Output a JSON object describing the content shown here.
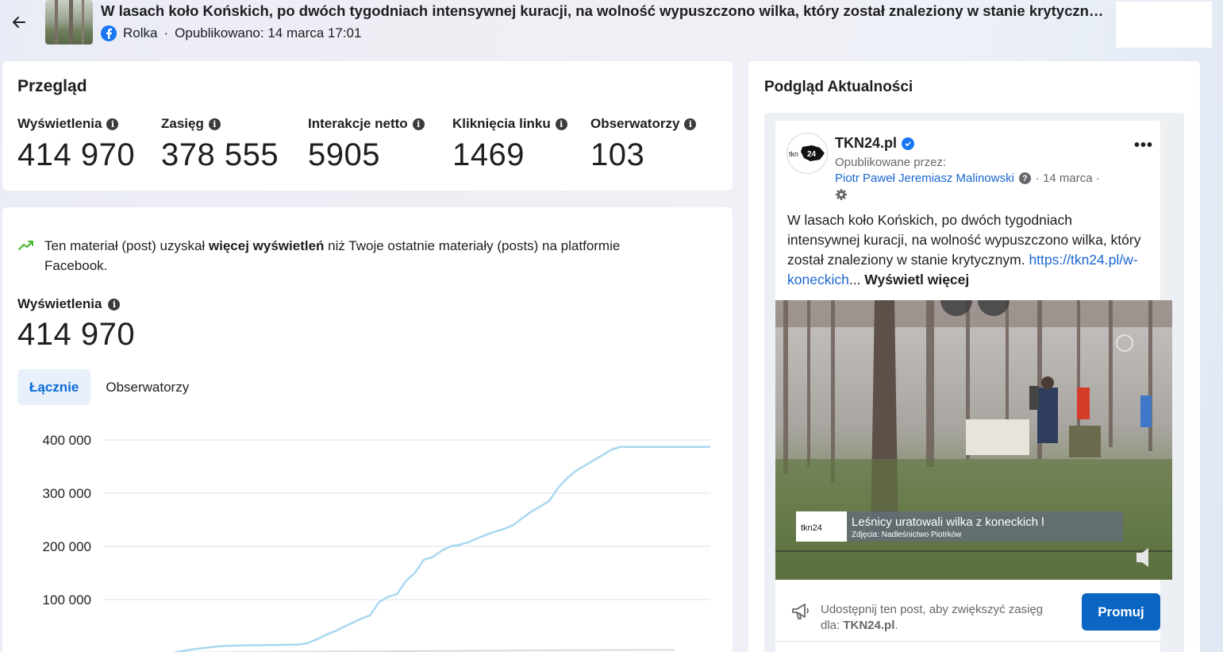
{
  "header": {
    "title": "W lasach koło Końskich, po dwóch tygodniach intensywnej kuracji, na wolność wypuszczono wilka, który został znaleziony w stanie krytycznym.",
    "type": "Rolka",
    "published": "Opublikowano: 14 marca 17:01"
  },
  "overview": {
    "title": "Przegląd",
    "metrics": [
      {
        "label": "Wyświetlenia",
        "value": "414 970"
      },
      {
        "label": "Zasięg",
        "value": "378 555"
      },
      {
        "label": "Interakcje netto",
        "value": "5905"
      },
      {
        "label": "Kliknięcia linku",
        "value": "1469"
      },
      {
        "label": "Obserwatorzy",
        "value": "103"
      }
    ]
  },
  "views": {
    "insight_pre": "Ten materiał (post) uzyskał ",
    "insight_bold": "więcej wyświetleń",
    "insight_post": " niż Twoje ostatnie materiały (posts) na platformie Facebook.",
    "label": "Wyświetlenia",
    "value": "414 970",
    "tabs": [
      "Łącznie",
      "Obserwatorzy"
    ]
  },
  "chart_data": {
    "type": "line",
    "ylim": [
      0,
      420000
    ],
    "yticks": [
      100000,
      200000,
      300000,
      400000
    ],
    "ytick_labels": [
      "100 000",
      "200 000",
      "300 000",
      "400 000"
    ],
    "grid": true,
    "series": [
      {
        "color": "#a8d8f0",
        "x": [
          0,
          2,
          4,
          6,
          8,
          10,
          12,
          14,
          16,
          18,
          20,
          22,
          24,
          26,
          28,
          30,
          32,
          34,
          36,
          38,
          40,
          42,
          44,
          46,
          48,
          50,
          52,
          54,
          56,
          58,
          60,
          62,
          64,
          66,
          68,
          70,
          72,
          74,
          76,
          78,
          80,
          82,
          84,
          86,
          88,
          90,
          92,
          94,
          96,
          98,
          100,
          102,
          104,
          106,
          108,
          110,
          112,
          114,
          116,
          118,
          120
        ],
        "values": [
          0,
          3000,
          6000,
          8000,
          10000,
          12000,
          13000,
          13500,
          14000,
          14200,
          14400,
          14600,
          14800,
          15000,
          15500,
          18000,
          25000,
          33000,
          40000,
          48000,
          56000,
          64000,
          70000,
          95000,
          105000,
          110000,
          135000,
          150000,
          175000,
          180000,
          192000,
          200000,
          203000,
          208000,
          215000,
          222000,
          228000,
          233000,
          240000,
          253000,
          265000,
          275000,
          285000,
          310000,
          328000,
          342000,
          352000,
          362000,
          372000,
          382000,
          387000,
          387000,
          387000,
          387000,
          387000,
          387000,
          387000,
          387000,
          387000,
          387000,
          387000
        ]
      },
      {
        "color": "#d9dbe0",
        "x": [
          0,
          20,
          40,
          60,
          80,
          100,
          112
        ],
        "values": [
          0,
          1500,
          2500,
          3500,
          4500,
          5200,
          5600
        ]
      }
    ]
  },
  "preview": {
    "title": "Podgląd Aktualności",
    "page_name": "TKN24.pl",
    "published_by": "Opublikowane przez:",
    "author": "Piotr Paweł Jeremiasz Malinowski",
    "date": "· 14 marca ·",
    "text": "W lasach koło Końskich, po dwóch tygodniach intensywnej kuracji, na wolność wypuszczono wilka, który został znaleziony w stanie krytycznym.",
    "link": "https://tkn24.pl/w-koneckich",
    "ellipsis": "...",
    "see_more": "Wyświetl więcej",
    "video_caption": "Leśnicy uratowali wilka z koneckich l",
    "video_credit": "Zdjęcia: Nadleśnictwo Piotrków",
    "logo_text": "tkn24",
    "share_text": "Udostępnij ten post, aby zwiększyć zasięg dla: ",
    "share_page": "TKN24.pl",
    "share_period": ".",
    "promote": "Promuj"
  },
  "colors": {
    "accent": "#0a66c2",
    "link": "#1a66d2",
    "chart_line": "#a8d8f0",
    "tab_active_bg": "#e7f0fb"
  }
}
